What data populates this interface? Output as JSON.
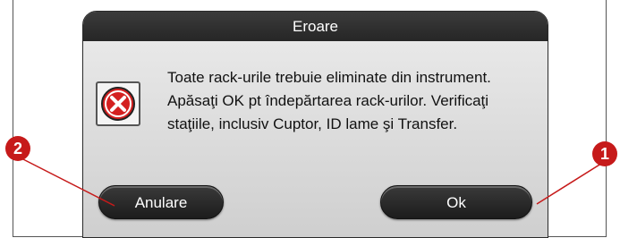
{
  "dialog": {
    "title": "Eroare",
    "message": "Toate rack-urile trebuie eliminate din instrument. Apăsaţi OK pt îndepărtarea rack-urilor. Verificaţi staţiile, inclusiv Cuptor, ID lame şi Transfer.",
    "icon": "error-icon",
    "cancel_label": "Anulare",
    "ok_label": "Ok"
  },
  "callouts": {
    "ok": "1",
    "cancel": "2"
  },
  "colors": {
    "titlebar": "#2c2c2c",
    "button": "#262626",
    "callout": "#c61a1a",
    "error_red": "#d42020"
  }
}
